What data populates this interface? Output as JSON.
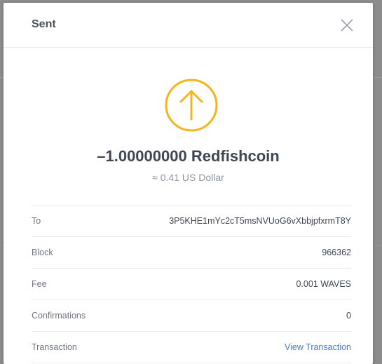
{
  "modal": {
    "title": "Sent"
  },
  "colors": {
    "accent": "#f5b51a",
    "link": "#4a79c8",
    "text": "#3f4752"
  },
  "icons": {
    "status": "arrow-up-circle-icon",
    "close": "close-icon"
  },
  "transaction": {
    "amount": "–1.00000000 Redfishcoin",
    "fiat": "≈ 0.41 US Dollar"
  },
  "details": [
    {
      "label": "To",
      "value": "3P5KHE1mYc2cT5msNVUoG6vXbbjpfxrmT8Y"
    },
    {
      "label": "Block",
      "value": "966362"
    },
    {
      "label": "Fee",
      "value": "0.001 WAVES"
    },
    {
      "label": "Confirmations",
      "value": "0"
    },
    {
      "label": "Transaction",
      "value": "View Transaction"
    }
  ]
}
